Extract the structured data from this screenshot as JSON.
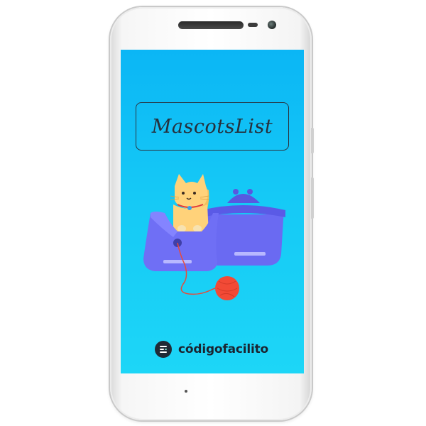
{
  "app": {
    "title": "MascotsList"
  },
  "brand": {
    "name": "códigofacilito",
    "logo_icon": "codigofacilito-logo-icon"
  },
  "colors": {
    "screen_top": "#0bb6f5",
    "screen_bottom": "#1dd6f7",
    "title_text": "#26303c",
    "bag": "#6f6ff5",
    "cat": "#ffd27a",
    "yarn": "#f04b3a",
    "brand_text": "#1b2430"
  },
  "icons": {
    "illustration": "cat-in-bag-illustration",
    "yarn": "yarn-ball-icon"
  }
}
